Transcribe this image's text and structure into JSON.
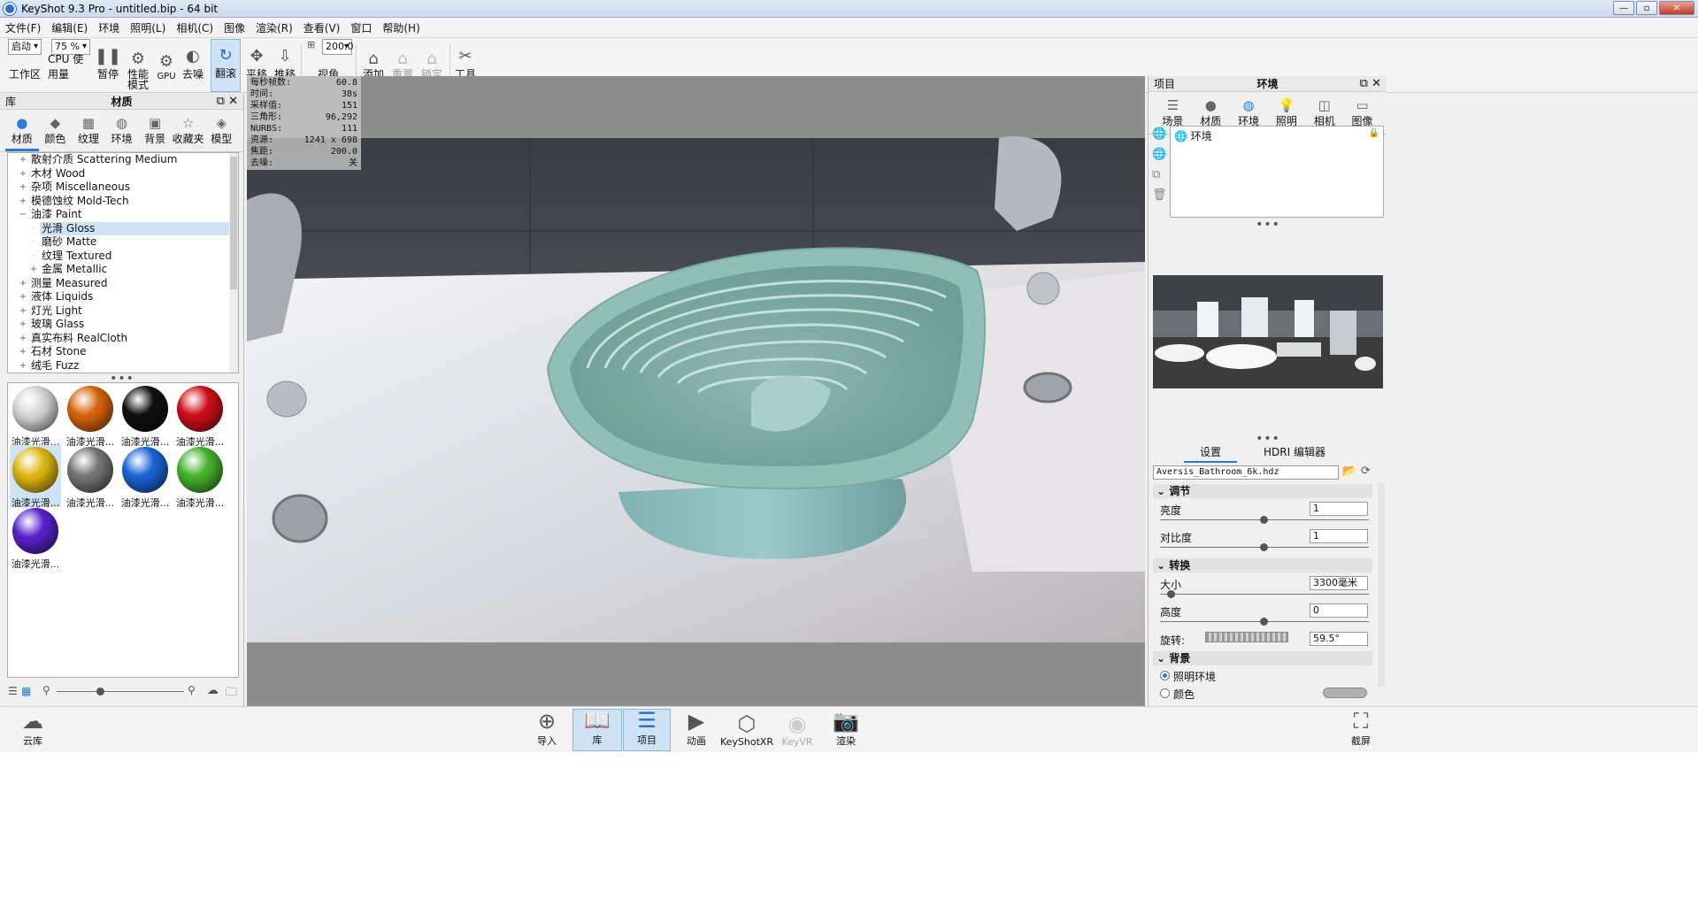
{
  "window": {
    "title": "KeyShot 9.3 Pro  - untitled.bip  - 64 bit"
  },
  "menu": [
    "文件(F)",
    "编辑(E)",
    "环境",
    "照明(L)",
    "相机(C)",
    "图像",
    "渲染(R)",
    "查看(V)",
    "窗口",
    "帮助(H)"
  ],
  "toolbar": {
    "workspace_value": "启动",
    "workspace_label": "工作区",
    "cpu_value": "75 %",
    "cpu_label": "CPU 使用量",
    "pause": "暂停",
    "perf_mode": "性能\n模式",
    "gpu": "GPU",
    "denoise": "去噪",
    "tumble": "翻滚",
    "pan": "平移",
    "dolly": "推移",
    "fov_value": "200.0",
    "fov": "视角",
    "add_camera": "添加\n相机",
    "reset_camera": "重置\n相机",
    "lock_camera": "锁定\n相机",
    "tools": "工具"
  },
  "library": {
    "header_left": "库",
    "header_title": "材质",
    "tabs": [
      {
        "label": "材质",
        "icon": "material-icon"
      },
      {
        "label": "颜色",
        "icon": "color-icon"
      },
      {
        "label": "纹理",
        "icon": "texture-icon"
      },
      {
        "label": "环境",
        "icon": "environment-icon"
      },
      {
        "label": "背景",
        "icon": "background-icon"
      },
      {
        "label": "收藏夹",
        "icon": "favorites-icon"
      },
      {
        "label": "模型",
        "icon": "model-icon"
      }
    ],
    "search_placeholder": "",
    "tree": [
      {
        "exp": "+",
        "indent": 0,
        "label": "散射介质 Scattering Medium"
      },
      {
        "exp": "+",
        "indent": 0,
        "label": "木材 Wood"
      },
      {
        "exp": "+",
        "indent": 0,
        "label": "杂项 Miscellaneous"
      },
      {
        "exp": "+",
        "indent": 0,
        "label": "模德蚀纹 Mold-Tech"
      },
      {
        "exp": "−",
        "indent": 0,
        "label": "油漆 Paint"
      },
      {
        "exp": "",
        "indent": 1,
        "label": "光滑 Gloss",
        "selected": true
      },
      {
        "exp": "",
        "indent": 1,
        "label": "磨砂 Matte"
      },
      {
        "exp": "",
        "indent": 1,
        "label": "纹理 Textured"
      },
      {
        "exp": "+",
        "indent": 1,
        "label": "金属 Metallic"
      },
      {
        "exp": "+",
        "indent": 0,
        "label": "测量 Measured"
      },
      {
        "exp": "+",
        "indent": 0,
        "label": "液体 Liquids"
      },
      {
        "exp": "+",
        "indent": 0,
        "label": "灯光 Light"
      },
      {
        "exp": "+",
        "indent": 0,
        "label": "玻璃 Glass"
      },
      {
        "exp": "+",
        "indent": 0,
        "label": "真实布料 RealCloth"
      },
      {
        "exp": "+",
        "indent": 0,
        "label": "石材 Stone"
      },
      {
        "exp": "+",
        "indent": 0,
        "label": "绒毛 Fuzz"
      }
    ],
    "materials": [
      {
        "label": "油漆光滑...",
        "color": "#d8d8d8"
      },
      {
        "label": "油漆光滑...",
        "color": "#d9650e"
      },
      {
        "label": "油漆光滑...",
        "color": "#111111"
      },
      {
        "label": "油漆光滑...",
        "color": "#d0101a"
      },
      {
        "label": "油漆光滑...",
        "color": "#e0b812",
        "selected": true
      },
      {
        "label": "油漆光滑...",
        "color": "#777777"
      },
      {
        "label": "油漆光滑...",
        "color": "#1a66d8"
      },
      {
        "label": "油漆光滑...",
        "color": "#44b52c"
      },
      {
        "label": "油漆光滑...",
        "color": "#5a22d0"
      }
    ]
  },
  "stats": [
    {
      "k": "每秒帧数:",
      "v": "60.8"
    },
    {
      "k": "时间:",
      "v": "38s"
    },
    {
      "k": "采样值:",
      "v": "151"
    },
    {
      "k": "三角形:",
      "v": "96,292"
    },
    {
      "k": "NURBS:",
      "v": "111"
    },
    {
      "k": "资源:",
      "v": "1241 x 698"
    },
    {
      "k": "焦距:",
      "v": "200.0"
    },
    {
      "k": "去噪:",
      "v": "关"
    }
  ],
  "project": {
    "header_left": "项目",
    "header_title": "环境",
    "tabs": [
      {
        "label": "场景",
        "icon": "scene-icon"
      },
      {
        "label": "材质",
        "icon": "material-icon"
      },
      {
        "label": "环境",
        "icon": "environment-icon",
        "active": true
      },
      {
        "label": "照明",
        "icon": "lighting-icon"
      },
      {
        "label": "相机",
        "icon": "camera-icon"
      },
      {
        "label": "图像",
        "icon": "image-icon"
      }
    ],
    "env_item": "环境",
    "subtab_settings": "设置",
    "subtab_hdri": "HDRI 编辑器",
    "hdr_file": "Aversis_Bathroom_6k.hdz",
    "sect_adjust": "调节",
    "brightness_label": "亮度",
    "brightness_value": "1",
    "contrast_label": "对比度",
    "contrast_value": "1",
    "sect_transform": "转换",
    "size_label": "大小",
    "size_value": "3300毫米",
    "height_label": "高度",
    "height_value": "0",
    "rotation_label": "旋转:",
    "rotation_value": "59.5°",
    "sect_background": "背景",
    "bg_lighting_env": "照明环境",
    "bg_color": "颜色"
  },
  "bottom": {
    "cloud_library": "云库",
    "import": "导入",
    "library": "库",
    "project": "项目",
    "animation": "动画",
    "keyshotxr": "KeyShotXR",
    "keyvr": "KeyVR",
    "render": "渲染",
    "screenshot": "截屏"
  }
}
